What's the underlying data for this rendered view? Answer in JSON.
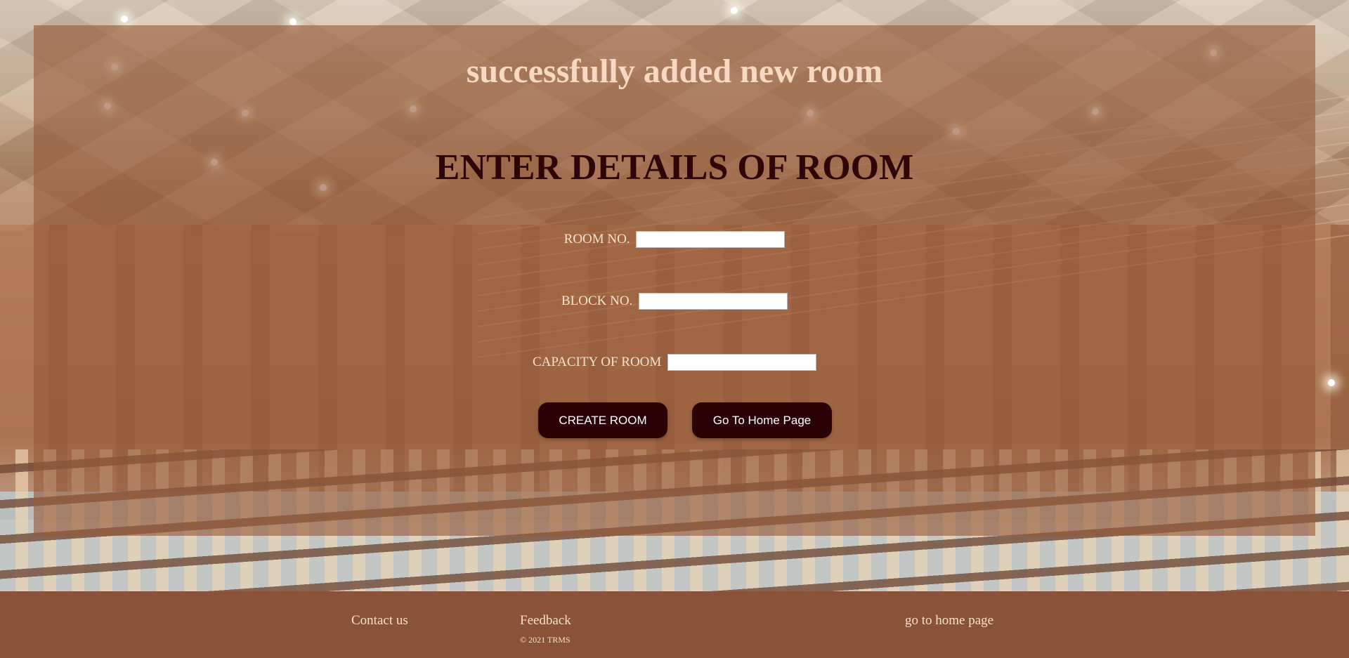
{
  "status": {
    "message": "successfully added new room"
  },
  "form": {
    "title": "ENTER DETAILS OF ROOM",
    "fields": [
      {
        "label": "ROOM NO.",
        "value": "",
        "placeholder": ""
      },
      {
        "label": "BLOCK NO.",
        "value": "",
        "placeholder": ""
      },
      {
        "label": "CAPACITY OF ROOM",
        "value": "",
        "placeholder": ""
      }
    ],
    "buttons": {
      "create": "CREATE ROOM",
      "home": "Go To Home Page"
    }
  },
  "footer": {
    "contact": "Contact us",
    "feedback": "Feedback",
    "copyright": "© 2021 TRMS",
    "home_link": "go to home page"
  },
  "colors": {
    "panel_overlay": "#965a3a",
    "footer_bg": "#8a5238",
    "button_bg": "#2b0306",
    "title_text": "#2e0606",
    "light_text": "#f6d9c0"
  }
}
